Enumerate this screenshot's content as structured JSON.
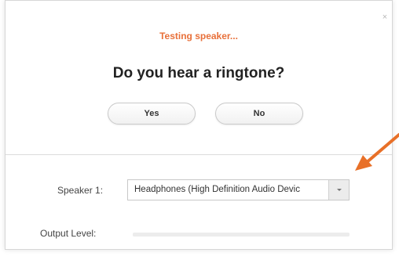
{
  "dialog": {
    "close_symbol": "×",
    "status_text": "Testing speaker...",
    "question": "Do you hear a ringtone?",
    "buttons": {
      "yes_label": "Yes",
      "no_label": "No"
    }
  },
  "speaker": {
    "label": "Speaker 1:",
    "selected_value": "Headphones (High Definition Audio Devic",
    "dropdown_icon": "chevron-down-icon"
  },
  "output": {
    "label": "Output Level:",
    "level": 0
  },
  "colors": {
    "status_accent": "#e8703a",
    "annotation_arrow": "#e87028"
  }
}
